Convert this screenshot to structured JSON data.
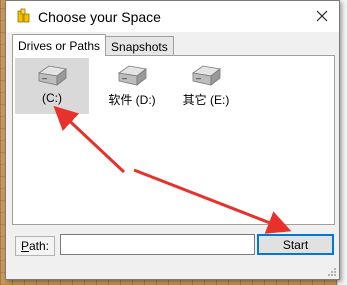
{
  "window": {
    "title": "Choose your Space",
    "close_icon": "close-icon",
    "app_icon": "app-icon"
  },
  "tabs": [
    {
      "label": "Drives or Paths",
      "active": true
    },
    {
      "label": "Snapshots",
      "active": false
    }
  ],
  "drives": [
    {
      "label": "(C:)",
      "selected": true,
      "icon": "drive-icon"
    },
    {
      "label": "软件 (D:)",
      "selected": false,
      "icon": "drive-icon"
    },
    {
      "label": "其它 (E:)",
      "selected": false,
      "icon": "drive-icon"
    }
  ],
  "path": {
    "label_prefix": "",
    "label_mnemonic": "P",
    "label_rest": "ath:",
    "value": "",
    "placeholder": ""
  },
  "start_button": {
    "label": "Start"
  },
  "colors": {
    "annotation_arrow": "#e8312a",
    "start_focus": "#0078d7",
    "selection": "#d9d9d9"
  }
}
